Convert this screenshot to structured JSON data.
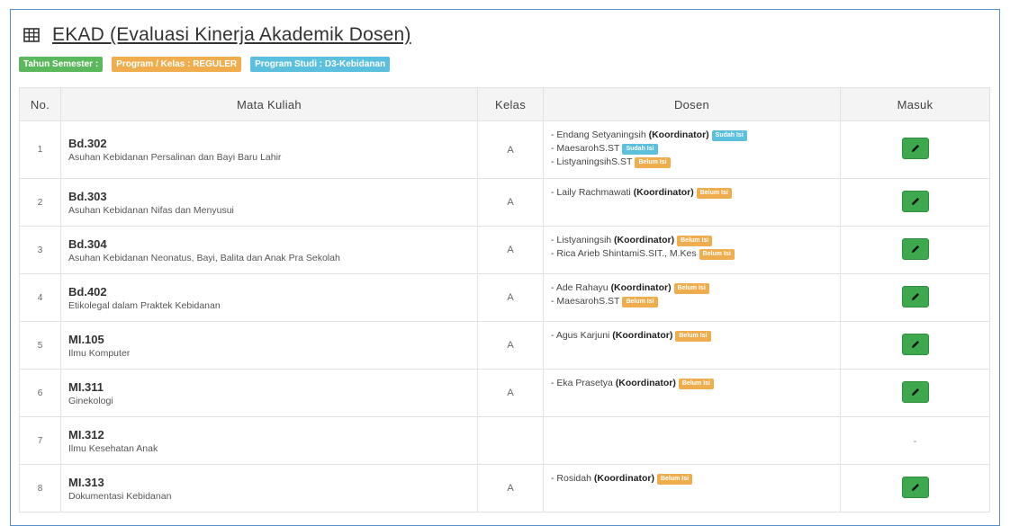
{
  "page": {
    "title": "EKAD (Evaluasi Kinerja Akademik Dosen)",
    "title_icon": "table-icon"
  },
  "badges": [
    {
      "label": "Tahun Semester :",
      "color": "#5cb85c"
    },
    {
      "label": "Program / Kelas : REGULER",
      "color": "#f0ad4e"
    },
    {
      "label": "Program Studi : D3-Kebidanan",
      "color": "#5bc0de"
    }
  ],
  "table": {
    "headers": {
      "no": "No.",
      "mata_kuliah": "Mata Kuliah",
      "kelas": "Kelas",
      "dosen": "Dosen",
      "masuk": "Masuk"
    },
    "rows": [
      {
        "no": "1",
        "code": "Bd.302",
        "name": "Asuhan Kebidanan Persalinan dan Bayi Baru Lahir",
        "kelas": "A",
        "dosen": [
          {
            "prefix": "- Endang Setyaningsih",
            "role": "(Koordinator)",
            "status": "Sudah Isi",
            "state": "ok"
          },
          {
            "prefix": "- MaesarohS.ST",
            "role": "",
            "status": "Sudah Isi",
            "state": "ok"
          },
          {
            "prefix": "- ListyaningsihS.ST",
            "role": "",
            "status": "Belum Isi",
            "state": "pending"
          }
        ],
        "masuk": "edit"
      },
      {
        "no": "2",
        "code": "Bd.303",
        "name": "Asuhan Kebidanan Nifas dan Menyusui",
        "kelas": "A",
        "dosen": [
          {
            "prefix": "- Laily Rachmawati",
            "role": "(Koordinator)",
            "status": "Belum Isi",
            "state": "pending"
          }
        ],
        "masuk": "edit"
      },
      {
        "no": "3",
        "code": "Bd.304",
        "name": "Asuhan Kebidanan Neonatus, Bayi, Balita dan Anak Pra Sekolah",
        "kelas": "A",
        "dosen": [
          {
            "prefix": "- Listyaningsih",
            "role": "(Koordinator)",
            "status": "Belum Isi",
            "state": "pending"
          },
          {
            "prefix": "- Rica Arieb ShintamiS.SIT., M.Kes",
            "role": "",
            "status": "Belum Isi",
            "state": "pending"
          }
        ],
        "masuk": "edit"
      },
      {
        "no": "4",
        "code": "Bd.402",
        "name": "Etikolegal dalam Praktek Kebidanan",
        "kelas": "A",
        "dosen": [
          {
            "prefix": "- Ade Rahayu",
            "role": "(Koordinator)",
            "status": "Belum Isi",
            "state": "pending"
          },
          {
            "prefix": "- MaesarohS.ST",
            "role": "",
            "status": "Belum Isi",
            "state": "pending"
          }
        ],
        "masuk": "edit"
      },
      {
        "no": "5",
        "code": "MI.105",
        "name": "Ilmu Komputer",
        "kelas": "A",
        "dosen": [
          {
            "prefix": "- Agus Karjuni",
            "role": "(Koordinator)",
            "status": "Belum Isi",
            "state": "pending"
          }
        ],
        "masuk": "edit"
      },
      {
        "no": "6",
        "code": "MI.311",
        "name": "Ginekologi",
        "kelas": "A",
        "dosen": [
          {
            "prefix": "- Eka Prasetya",
            "role": "(Koordinator)",
            "status": "Belum Isi",
            "state": "pending"
          }
        ],
        "masuk": "edit"
      },
      {
        "no": "7",
        "code": "MI.312",
        "name": "Ilmu Kesehatan Anak",
        "kelas": "",
        "dosen": [],
        "masuk": "-"
      },
      {
        "no": "8",
        "code": "MI.313",
        "name": "Dokumentasi Kebidanan",
        "kelas": "A",
        "dosen": [
          {
            "prefix": "- Rosidah",
            "role": "(Koordinator)",
            "status": "Belum Isi",
            "state": "pending"
          }
        ],
        "masuk": "edit"
      }
    ]
  },
  "colors": {
    "border": "#5b8fc7",
    "edit_button": "#3da84e",
    "status_ok": "#5bc0de",
    "status_pending": "#f0ad4e"
  }
}
